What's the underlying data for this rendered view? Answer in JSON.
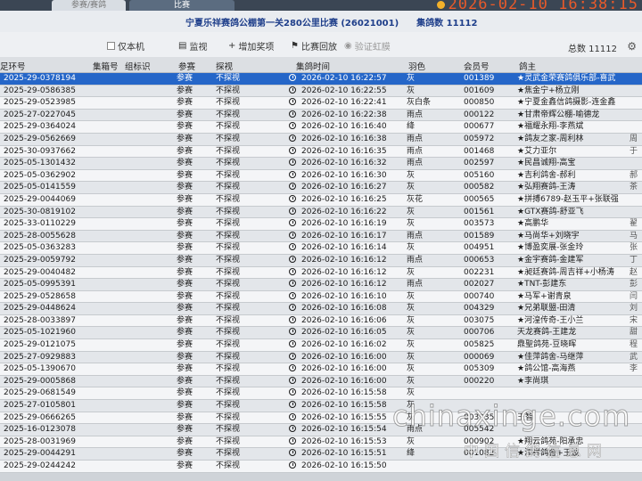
{
  "tabs": [
    {
      "label": "参赛/赛鸽",
      "active": false
    },
    {
      "label": "比赛",
      "active": true
    }
  ],
  "clock": "2026-02-10 16:38:15",
  "title": "宁夏乐祥赛鸽公棚第一关280公里比赛 (26021001)",
  "collected_label": "集鸽数 11112",
  "toolbar": {
    "only_local": "仅本机",
    "monitor": "监视",
    "add_item": "增加奖项",
    "race_reset": "比赛回放",
    "verify": "验证虹膜"
  },
  "total_label": "总数 11112",
  "columns": {
    "ring": "足环号",
    "cage": "集箱号",
    "group": "组标识",
    "type": "参赛",
    "watch": "探视",
    "time": "集鸽时间",
    "color": "羽色",
    "member": "会员号",
    "owner": "鸽主"
  },
  "rows": [
    {
      "ring": "2025-29-0378194",
      "type": "参赛",
      "watch": "不探视",
      "time": "2026-02-10 16:22:57",
      "color": "灰",
      "member": "001389",
      "owner": "★灵武金荣赛鸽俱乐部-喜武",
      "extra": "",
      "selected": true
    },
    {
      "ring": "2025-29-0586385",
      "type": "参赛",
      "watch": "不探视",
      "time": "2026-02-10 16:22:55",
      "color": "灰",
      "member": "001609",
      "owner": "★焦金宁+杨立刚",
      "extra": "",
      "selected": false
    },
    {
      "ring": "2025-29-0523985",
      "type": "参赛",
      "watch": "不探视",
      "time": "2026-02-10 16:22:41",
      "color": "灰白条",
      "member": "000850",
      "owner": "★宁夏金鑫信鸽摄影-连金鑫",
      "extra": "",
      "selected": false
    },
    {
      "ring": "2025-27-0227045",
      "type": "参赛",
      "watch": "不探视",
      "time": "2026-02-10 16:22:38",
      "color": "雨点",
      "member": "000122",
      "owner": "★甘肃帝辉公棚-喻德龙",
      "extra": "",
      "selected": false
    },
    {
      "ring": "2025-29-0364024",
      "type": "参赛",
      "watch": "不探视",
      "time": "2026-02-10 16:16:40",
      "color": "绛",
      "member": "000677",
      "owner": "★福耀永翔-李燕斌",
      "extra": "",
      "selected": false
    },
    {
      "ring": "2025-29-0562669",
      "type": "参赛",
      "watch": "不探视",
      "time": "2026-02-10 16:16:38",
      "color": "雨点",
      "member": "005972",
      "owner": "★鸽友之家-周利林",
      "extra": "周",
      "selected": false
    },
    {
      "ring": "2025-30-0937662",
      "type": "参赛",
      "watch": "不探视",
      "time": "2026-02-10 16:16:35",
      "color": "雨点",
      "member": "001468",
      "owner": "★艾力亚尔",
      "extra": "于",
      "selected": false
    },
    {
      "ring": "2025-05-1301432",
      "type": "参赛",
      "watch": "不探视",
      "time": "2026-02-10 16:16:32",
      "color": "雨点",
      "member": "002597",
      "owner": "★民昌诚翔-高宝",
      "extra": "",
      "selected": false
    },
    {
      "ring": "2025-05-0362902",
      "type": "参赛",
      "watch": "不探视",
      "time": "2026-02-10 16:16:30",
      "color": "灰",
      "member": "005160",
      "owner": "★吉利鸽舍-郝利",
      "extra": "郝",
      "selected": false
    },
    {
      "ring": "2025-05-0141559",
      "type": "参赛",
      "watch": "不探视",
      "time": "2026-02-10 16:16:27",
      "color": "灰",
      "member": "000582",
      "owner": "★弘翔赛鸽-王涛",
      "extra": "茶",
      "selected": false
    },
    {
      "ring": "2025-29-0044069",
      "type": "参赛",
      "watch": "不探视",
      "time": "2026-02-10 16:16:25",
      "color": "灰花",
      "member": "000565",
      "owner": "★拼搏6789-赵玉平+张联强",
      "extra": "",
      "selected": false
    },
    {
      "ring": "2025-30-0819102",
      "type": "参赛",
      "watch": "不探视",
      "time": "2026-02-10 16:16:22",
      "color": "灰",
      "member": "001561",
      "owner": "★GTX赛鸽-舒亚飞",
      "extra": "",
      "selected": false
    },
    {
      "ring": "2025-33-0110229",
      "type": "参赛",
      "watch": "不探视",
      "time": "2026-02-10 16:16:19",
      "color": "灰",
      "member": "003573",
      "owner": "★高鹏华",
      "extra": "翟",
      "selected": false
    },
    {
      "ring": "2025-28-0055628",
      "type": "参赛",
      "watch": "不探视",
      "time": "2026-02-10 16:16:17",
      "color": "雨点",
      "member": "001589",
      "owner": "★马尚华+刘晓宇",
      "extra": "马",
      "selected": false
    },
    {
      "ring": "2025-05-0363283",
      "type": "参赛",
      "watch": "不探视",
      "time": "2026-02-10 16:16:14",
      "color": "灰",
      "member": "004951",
      "owner": "★博盈奕展-张金玲",
      "extra": "张",
      "selected": false
    },
    {
      "ring": "2025-29-0059792",
      "type": "参赛",
      "watch": "不探视",
      "time": "2026-02-10 16:16:12",
      "color": "雨点",
      "member": "000653",
      "owner": "★金宇赛鸽-金建军",
      "extra": "丁",
      "selected": false
    },
    {
      "ring": "2025-29-0040482",
      "type": "参赛",
      "watch": "不探视",
      "time": "2026-02-10 16:16:12",
      "color": "灰",
      "member": "002231",
      "owner": "★昶廷赛鸽-周吉祥+小杨涛",
      "extra": "赵",
      "selected": false
    },
    {
      "ring": "2025-05-0995391",
      "type": "参赛",
      "watch": "不探视",
      "time": "2026-02-10 16:16:12",
      "color": "雨点",
      "member": "002027",
      "owner": "★TNT-彭建东",
      "extra": "彭",
      "selected": false
    },
    {
      "ring": "2025-29-0528658",
      "type": "参赛",
      "watch": "不探视",
      "time": "2026-02-10 16:16:10",
      "color": "灰",
      "member": "000740",
      "owner": "★马军+谢青泉",
      "extra": "闫",
      "selected": false
    },
    {
      "ring": "2025-29-0448624",
      "type": "参赛",
      "watch": "不探视",
      "time": "2026-02-10 16:16:08",
      "color": "灰",
      "member": "004329",
      "owner": "★兄弟联盟-田清",
      "extra": "刘",
      "selected": false
    },
    {
      "ring": "2025-28-0033897",
      "type": "参赛",
      "watch": "不探视",
      "time": "2026-02-10 16:16:06",
      "color": "灰",
      "member": "003075",
      "owner": "★河湟传奇-王小兰",
      "extra": "宋",
      "selected": false
    },
    {
      "ring": "2025-05-1021960",
      "type": "参赛",
      "watch": "不探视",
      "time": "2026-02-10 16:16:05",
      "color": "灰",
      "member": "000706",
      "owner": "天龙赛鸽-王建龙",
      "extra": "甜",
      "selected": false
    },
    {
      "ring": "2025-29-0121075",
      "type": "参赛",
      "watch": "不探视",
      "time": "2026-02-10 16:16:02",
      "color": "灰",
      "member": "005825",
      "owner": "鼎聖鸽苑-豆晓晖",
      "extra": "程",
      "selected": false
    },
    {
      "ring": "2025-27-0929883",
      "type": "参赛",
      "watch": "不探视",
      "time": "2026-02-10 16:16:00",
      "color": "灰",
      "member": "000069",
      "owner": "★佳萍鸽舍-马继萍",
      "extra": "武",
      "selected": false
    },
    {
      "ring": "2025-05-1390670",
      "type": "参赛",
      "watch": "不探视",
      "time": "2026-02-10 16:16:00",
      "color": "灰",
      "member": "005309",
      "owner": "★鸽公馆-高海燕",
      "extra": "李",
      "selected": false
    },
    {
      "ring": "2025-29-0005868",
      "type": "参赛",
      "watch": "不探视",
      "time": "2026-02-10 16:16:00",
      "color": "灰",
      "member": "000220",
      "owner": "★李尚琪",
      "extra": "",
      "selected": false
    },
    {
      "ring": "2025-29-0681549",
      "type": "参赛",
      "watch": "不探视",
      "time": "2026-02-10 16:15:58",
      "color": "灰",
      "member": "",
      "owner": "",
      "extra": "",
      "selected": false
    },
    {
      "ring": "2025-27-0105801",
      "type": "参赛",
      "watch": "不探视",
      "time": "2026-02-10 16:15:58",
      "color": "灰",
      "member": "",
      "owner": "",
      "extra": "",
      "selected": false
    },
    {
      "ring": "2025-29-0666265",
      "type": "参赛",
      "watch": "不探视",
      "time": "2026-02-10 16:15:55",
      "color": "灰",
      "member": "003935",
      "owner": "王智",
      "extra": "",
      "selected": false
    },
    {
      "ring": "2025-16-0123078",
      "type": "参赛",
      "watch": "不探视",
      "time": "2026-02-10 16:15:54",
      "color": "雨点",
      "member": "005542",
      "owner": "",
      "extra": "",
      "selected": false
    },
    {
      "ring": "2025-28-0031969",
      "type": "参赛",
      "watch": "不探视",
      "time": "2026-02-10 16:15:53",
      "color": "灰",
      "member": "000902",
      "owner": "★翔云鸽苑-阳承忠",
      "extra": "",
      "selected": false
    },
    {
      "ring": "2025-29-0044291",
      "type": "参赛",
      "watch": "不探视",
      "time": "2026-02-10 16:15:51",
      "color": "绛",
      "member": "001082",
      "owner": "★添祥鸽舍+王波",
      "extra": "",
      "selected": false
    },
    {
      "ring": "2025-29-0244242",
      "type": "参赛",
      "watch": "不探视",
      "time": "2026-02-10 16:15:50",
      "color": "",
      "member": "",
      "owner": "",
      "extra": "",
      "selected": false
    }
  ],
  "watermark": {
    "site": "chinaxinge.com",
    "name": "中国信鸽信息网"
  }
}
